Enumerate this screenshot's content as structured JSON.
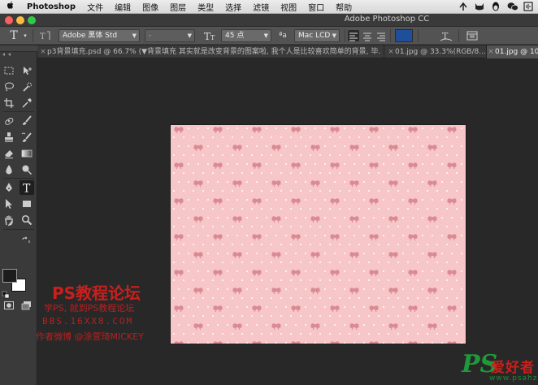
{
  "menubar": {
    "apple": "",
    "app_name": "Photoshop",
    "items": [
      "文件",
      "编辑",
      "图像",
      "图层",
      "类型",
      "选择",
      "滤镜",
      "视图",
      "窗口",
      "帮助"
    ]
  },
  "window": {
    "title": "Adobe Photoshop CC"
  },
  "options_bar": {
    "font_family": "Adobe 黑体 Std",
    "font_style": "-",
    "font_size": "45 点",
    "aa_label": "ªa",
    "antialias": "Mac LCD",
    "text_color": "#1f4f9a"
  },
  "tabs": [
    {
      "label": "p3背景填充.psd @ 66.7% (▼背景填充 其实就是改变背景的图案啦, 我个人是比较喜欢简单的背景, 毕...",
      "active": false
    },
    {
      "label": "01.jpg @ 33.3%(RGB/8...",
      "active": false
    },
    {
      "label": "01.jpg @ 10",
      "active": true
    }
  ],
  "toolbox": {
    "foreground_color": "#1c1c1c",
    "background_color": "#ffffff"
  },
  "canvas": {
    "pattern_bg": "#f6c6c8",
    "pattern_bow": "#d98a92",
    "pattern_dot": "#ffffff"
  },
  "watermark": {
    "title": "PS教程论坛",
    "line1": "学PS, 就到PS教程论坛",
    "line2": "BBS.16XX8.COM",
    "line3": "作者微博 @涂萱琦MICKEY"
  },
  "logo": {
    "ps": "PS",
    "cn": "爱好者",
    "url": "www.psahz.com"
  }
}
